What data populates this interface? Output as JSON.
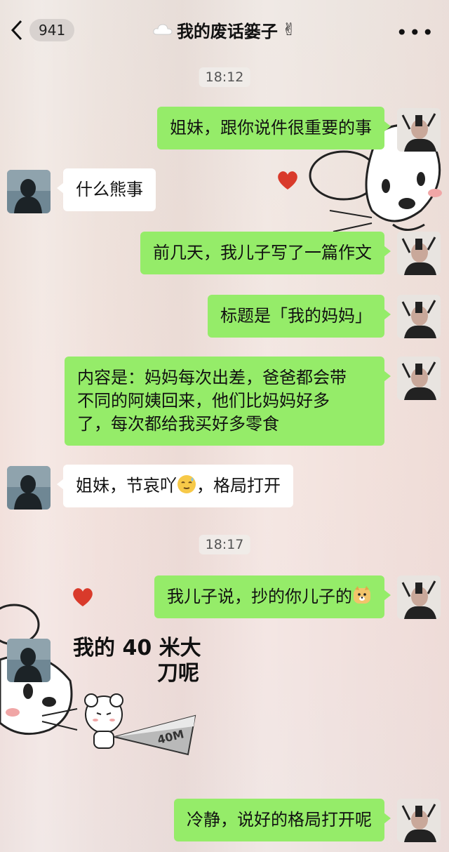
{
  "header": {
    "unread_count": "941",
    "title": "我的废话篓子",
    "title_emoji": "✌",
    "more": "•••"
  },
  "timestamps": [
    "18:12",
    "18:17"
  ],
  "messages": [
    {
      "side": "right",
      "text": "姐妹，跟你说件很重要的事"
    },
    {
      "side": "left",
      "text": "什么熊事"
    },
    {
      "side": "right",
      "text": "前几天，我儿子写了一篇作文"
    },
    {
      "side": "right",
      "text": "标题是「我的妈妈」"
    },
    {
      "side": "right",
      "lines": [
        "内容是：妈妈每次出差，爸爸都会带",
        "不同的阿姨回来，他们比妈妈好多",
        "了，每次都给我买好多零食"
      ]
    },
    {
      "side": "left",
      "text_before": "姐妹，节哀吖",
      "emoji": "relieved-sweat-emoji",
      "text_after": "，格局打开"
    },
    {
      "side": "right",
      "text": "我儿子说，抄的你儿子的",
      "emoji": "doge-emoji"
    },
    {
      "side": "left",
      "sticker": {
        "lines": [
          "我的 40 米大",
          "刀呢"
        ],
        "blade_text": "40M"
      }
    },
    {
      "side": "right",
      "text": "冷静，说好的格局打开呢"
    }
  ],
  "colors": {
    "right_bubble": "#95ec69",
    "left_bubble": "#ffffff",
    "heart": "#d93a2b"
  }
}
